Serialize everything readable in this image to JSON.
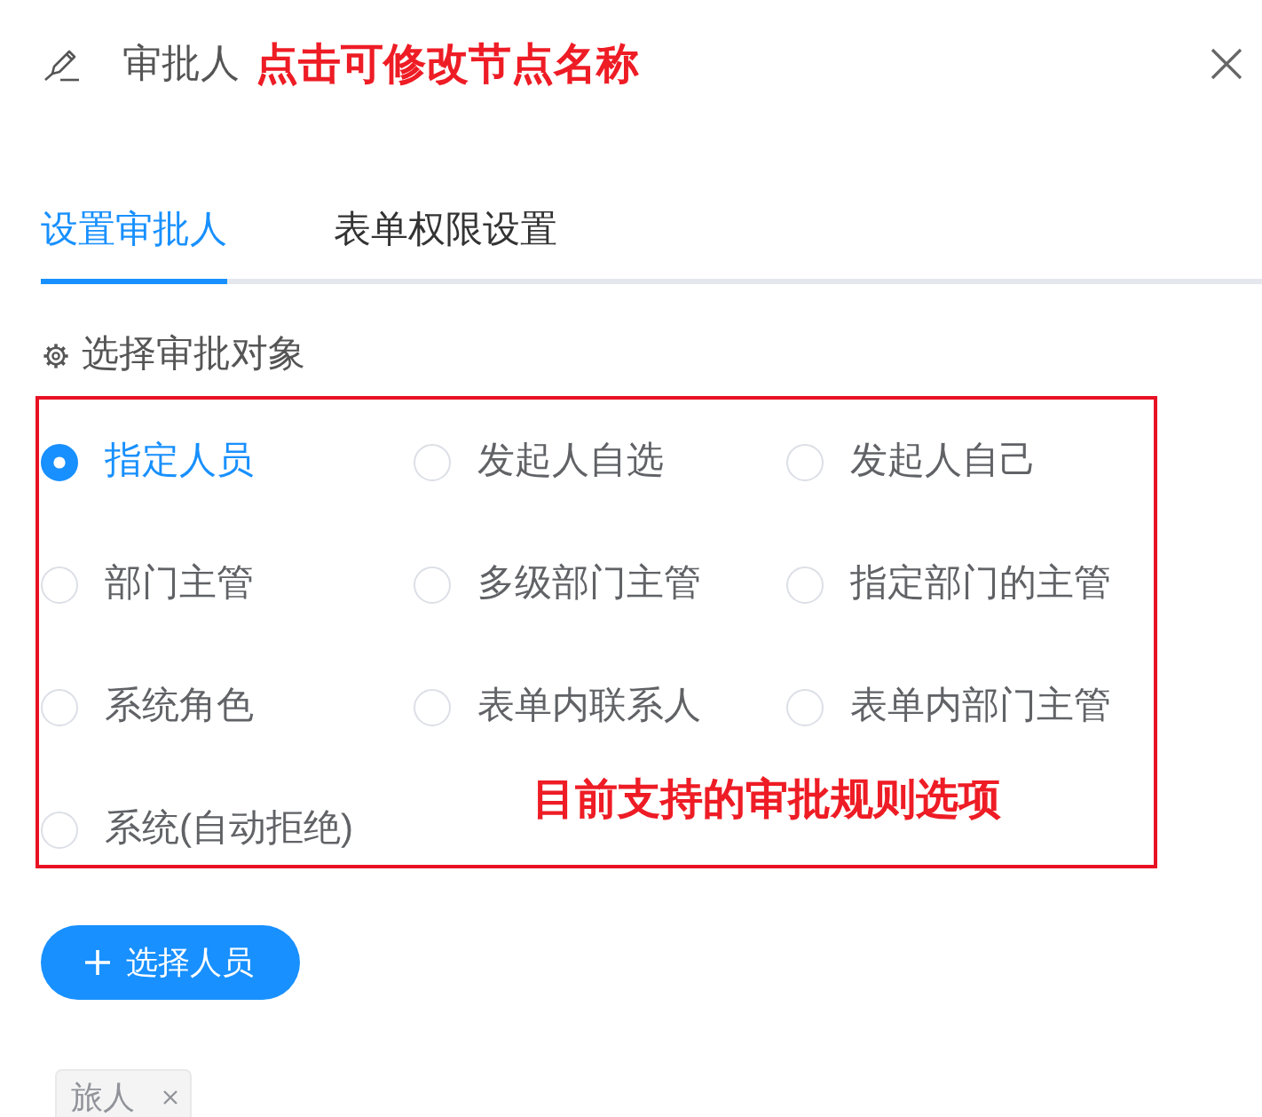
{
  "header": {
    "title": "审批人",
    "annotation": "点击可修改节点名称"
  },
  "tabs": [
    {
      "label": "设置审批人",
      "selected": true
    },
    {
      "label": "表单权限设置",
      "selected": false
    }
  ],
  "section": {
    "label": "选择审批对象"
  },
  "approver_options": {
    "options": [
      {
        "label": "指定人员",
        "selected": true
      },
      {
        "label": "发起人自选",
        "selected": false
      },
      {
        "label": "发起人自己",
        "selected": false
      },
      {
        "label": "部门主管",
        "selected": false
      },
      {
        "label": "多级部门主管",
        "selected": false
      },
      {
        "label": "指定部门的主管",
        "selected": false
      },
      {
        "label": "系统角色",
        "selected": false
      },
      {
        "label": "表单内联系人",
        "selected": false
      },
      {
        "label": "表单内部门主管",
        "selected": false
      },
      {
        "label": "系统(自动拒绝)",
        "selected": false
      }
    ],
    "annotation": "目前支持的审批规则选项"
  },
  "select_button": {
    "label": "选择人员"
  },
  "selected_people": [
    {
      "label": "旅人"
    }
  ]
}
